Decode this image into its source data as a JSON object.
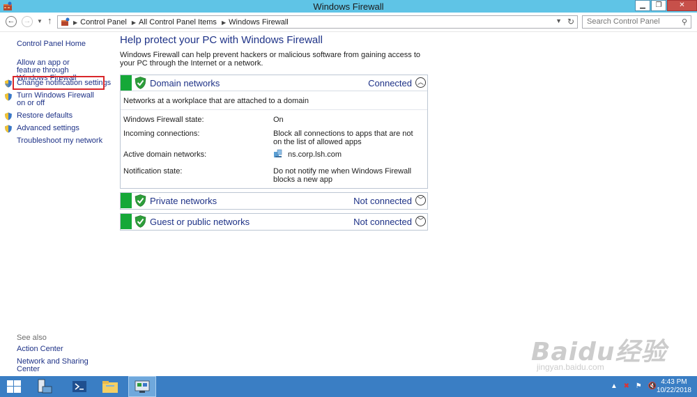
{
  "window": {
    "title": "Windows Firewall",
    "minimize": "▁",
    "restore": "❐",
    "close": "✕"
  },
  "address": {
    "crumbs": [
      "Control Panel",
      "All Control Panel Items",
      "Windows Firewall"
    ],
    "search_placeholder": "Search Control Panel"
  },
  "sidebar": {
    "home": "Control Panel Home",
    "allow_app": "Allow an app or feature through Windows Firewall",
    "change_notification": "Change notification settings",
    "turn_on_off": "Turn Windows Firewall on or off",
    "restore_defaults": "Restore defaults",
    "advanced": "Advanced settings",
    "troubleshoot": "Troubleshoot my network",
    "see_also": "See also",
    "action_center": "Action Center",
    "network_sharing": "Network and Sharing Center"
  },
  "main": {
    "heading": "Help protect your PC with Windows Firewall",
    "description": "Windows Firewall can help prevent hackers or malicious software from gaining access to your PC through the Internet or a network."
  },
  "networks": [
    {
      "name": "Domain networks",
      "status": "Connected",
      "expanded": true,
      "subtitle": "Networks at a workplace that are attached to a domain",
      "rows": [
        {
          "key": "Windows Firewall state:",
          "value": "On"
        },
        {
          "key": "Incoming connections:",
          "value": "Block all connections to apps that are not on the list of allowed apps"
        },
        {
          "key": "Active domain networks:",
          "value": "ns.corp.lsh.com"
        },
        {
          "key": "Notification state:",
          "value": "Do not notify me when Windows Firewall blocks a new app"
        }
      ]
    },
    {
      "name": "Private networks",
      "status": "Not connected",
      "expanded": false
    },
    {
      "name": "Guest or public networks",
      "status": "Not connected",
      "expanded": false
    }
  ],
  "taskbar": {
    "time": "4:43 PM",
    "date": "10/22/2018"
  },
  "watermark": {
    "line1": "Baidu经验",
    "line2": "jingyan.baidu.com"
  },
  "colors": {
    "titlebar": "#5fc4e6",
    "link": "#1e3287",
    "green": "#15a838",
    "highlight": "#d9262a",
    "taskbar": "#3a7ec4"
  }
}
